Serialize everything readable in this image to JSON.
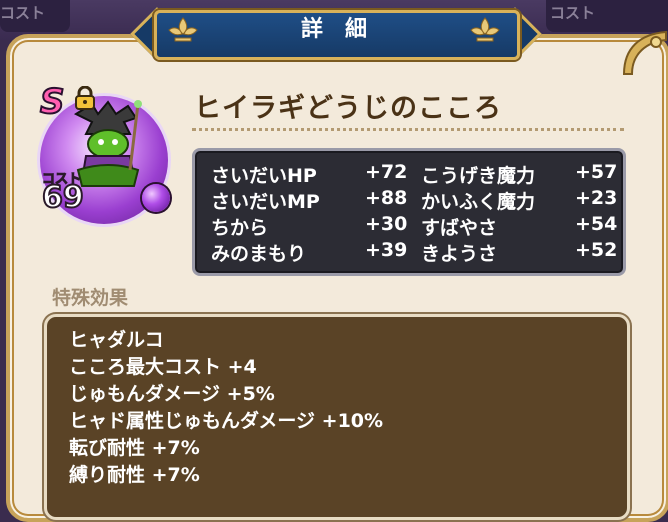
{
  "header": {
    "title": "詳細",
    "bg_left_stub": "コスト",
    "bg_right_stub": "コスト"
  },
  "item": {
    "rank": "S",
    "name": "ヒイラギどうじのこころ",
    "cost_label": "コスト",
    "cost_value": "69",
    "lock_icon": "lock-icon",
    "gem_color": "#b04ee8"
  },
  "stats": [
    {
      "label": "さいだいHP",
      "value": "+72",
      "label2": "こうげき魔力",
      "value2": "+57"
    },
    {
      "label": "さいだいMP",
      "value": "+88",
      "label2": "かいふく魔力",
      "value2": "+23"
    },
    {
      "label": "ちから",
      "value": "+30",
      "label2": "すばやさ",
      "value2": "+54"
    },
    {
      "label": "みのまもり",
      "value": "+39",
      "label2": "きようさ",
      "value2": "+52"
    }
  ],
  "effects": {
    "label": "特殊効果",
    "lines": [
      "ヒャダルコ",
      "こころ最大コスト +4",
      "じゅもんダメージ +5%",
      "ヒャド属性じゅもんダメージ +10%",
      "転び耐性 +7%",
      "縛り耐性 +7%"
    ]
  },
  "colors": {
    "panel": "#f3eadb",
    "gold_border": "#c7a35a",
    "title_blue": "#1f4e86",
    "stats_bg": "#2c2c34",
    "effects_bg": "#5a4326",
    "name_text": "#4a3216"
  }
}
